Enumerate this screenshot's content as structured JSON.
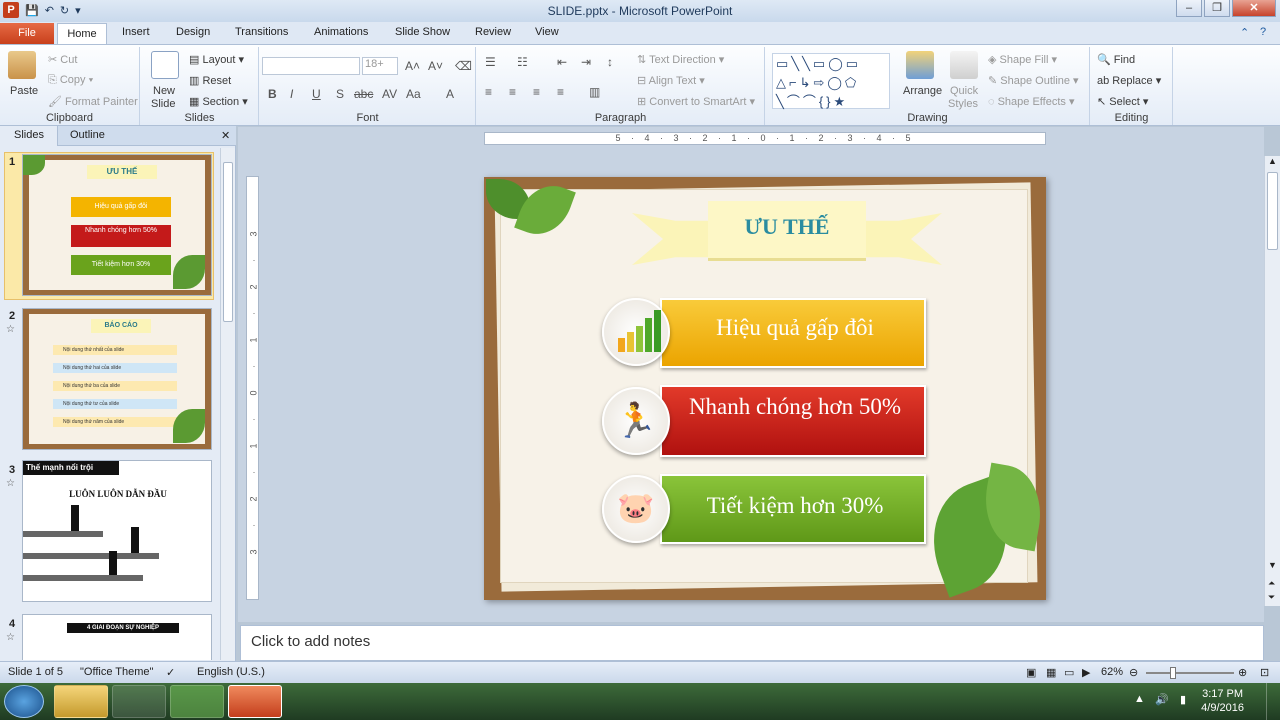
{
  "window": {
    "title": "SLIDE.pptx - Microsoft PowerPoint",
    "app_icon": "P"
  },
  "tabs": [
    "File",
    "Home",
    "Insert",
    "Design",
    "Transitions",
    "Animations",
    "Slide Show",
    "Review",
    "View"
  ],
  "clipboard": {
    "paste": "Paste",
    "cut": "Cut",
    "copy": "Copy",
    "format_painter": "Format Painter",
    "label": "Clipboard"
  },
  "slides_group": {
    "new_slide": "New",
    "new_slide2": "Slide",
    "layout": "Layout",
    "reset": "Reset",
    "section": "Section",
    "label": "Slides"
  },
  "font_group": {
    "size": "18+",
    "label": "Font"
  },
  "paragraph_group": {
    "text_direction": "Text Direction",
    "align_text": "Align Text",
    "convert": "Convert to SmartArt",
    "label": "Paragraph"
  },
  "drawing_group": {
    "arrange": "Arrange",
    "quick": "Quick",
    "styles": "Styles",
    "shape_fill": "Shape Fill",
    "shape_outline": "Shape Outline",
    "shape_effects": "Shape Effects",
    "label": "Drawing"
  },
  "editing_group": {
    "find": "Find",
    "replace": "Replace",
    "select": "Select",
    "label": "Editing"
  },
  "left_pane": {
    "tab_slides": "Slides",
    "tab_outline": "Outline"
  },
  "thumbs": {
    "t1": {
      "num": "1",
      "title": "ƯU THẾ",
      "r1": "Hiệu quả gấp đôi",
      "r2": "Nhanh chóng hơn 50%",
      "r3": "Tiết kiệm hơn 30%"
    },
    "t2": {
      "num": "2",
      "title": "BÁO CÁO",
      "lines": [
        "Nội dung thứ nhất của slide",
        "Nội dung thứ hai của slide",
        "Nội dung thứ ba của slide",
        "Nội dung thứ tư của slide",
        "Nội dung thứ năm của slide"
      ]
    },
    "t3": {
      "num": "3",
      "title": "Thế mạnh nổi trội",
      "subtitle": "LUÔN LUÔN DẪN ĐẦU"
    },
    "t4": {
      "num": "4",
      "title": "4 GIAI ĐOẠN SỰ NGHIỆP"
    }
  },
  "ruler_h": "5 · 4 · 3 · 2 · 1 · 0 · 1 · 2 · 3 · 4 · 5",
  "ruler_v": "3 · 2 · 1 · 0 · 1 · 2 · 3",
  "slide": {
    "title": "ƯU THẾ",
    "item1": "Hiệu quả gấp đôi",
    "item2": "Nhanh chóng hơn 50%",
    "item3": "Tiết kiệm hơn 30%",
    "colors": {
      "gold": "#f4b400",
      "red": "#c41a1a",
      "green": "#6aa31c",
      "frame": "#9a6b3c",
      "paper": "#f7f1e6"
    }
  },
  "notes": "Click to add notes",
  "status": {
    "slide": "Slide 1 of 5",
    "theme": "\"Office Theme\"",
    "language": "English (U.S.)",
    "zoom": "62%"
  },
  "taskbar": {
    "time": "3:17 PM",
    "date": "4/9/2016"
  }
}
